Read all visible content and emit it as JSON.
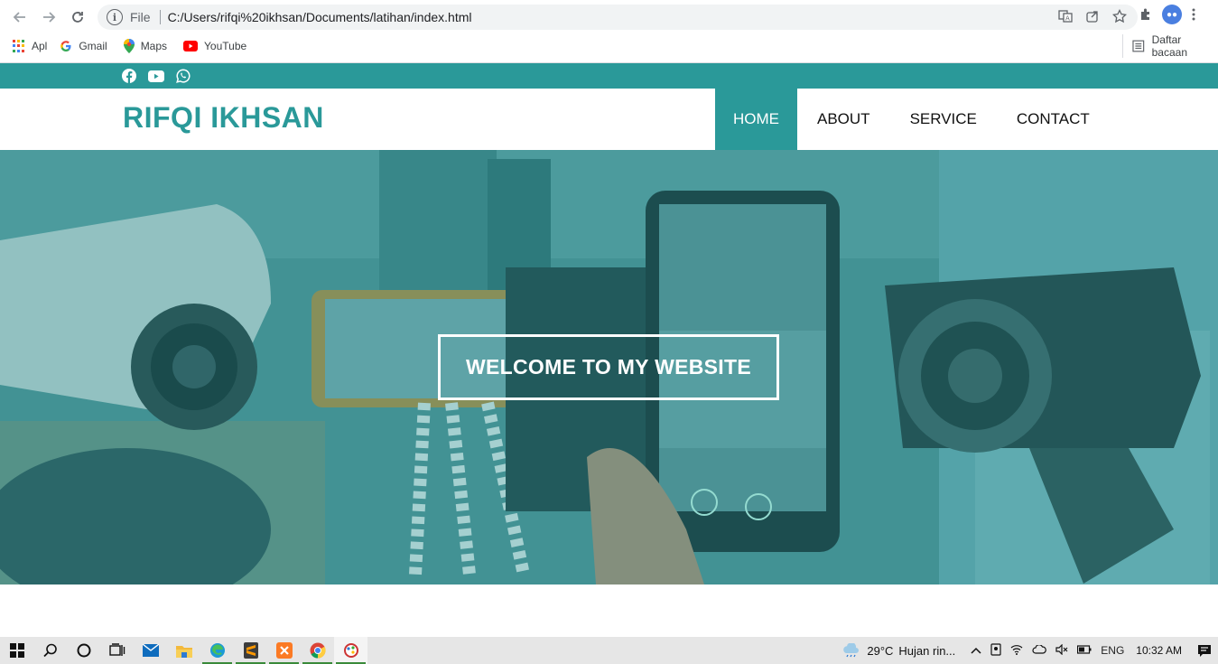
{
  "browser": {
    "url_scheme": "File",
    "url": "C:/Users/rifqi%20ikhsan/Documents/latihan/index.html",
    "bookmarks": [
      {
        "label": "Apl",
        "icon": "apps-grid-icon"
      },
      {
        "label": "Gmail",
        "icon": "google-icon"
      },
      {
        "label": "Maps",
        "icon": "maps-pin-icon"
      },
      {
        "label": "YouTube",
        "icon": "youtube-icon"
      }
    ],
    "reading_list": "Daftar bacaan"
  },
  "site": {
    "social_icons": [
      "facebook-icon",
      "youtube-icon",
      "whatsapp-icon"
    ],
    "brand": "RIFQI IKHSAN",
    "menu": [
      {
        "label": "HOME",
        "active": true
      },
      {
        "label": "ABOUT",
        "active": false
      },
      {
        "label": "SERVICE",
        "active": false
      },
      {
        "label": "CONTACT",
        "active": false
      }
    ],
    "hero_title": "WELCOME TO MY WEBSITE",
    "accent_color": "#2a9999"
  },
  "taskbar": {
    "weather_temp": "29°C",
    "weather_text": "Hujan rin...",
    "language": "ENG",
    "time": "10:32 AM"
  }
}
